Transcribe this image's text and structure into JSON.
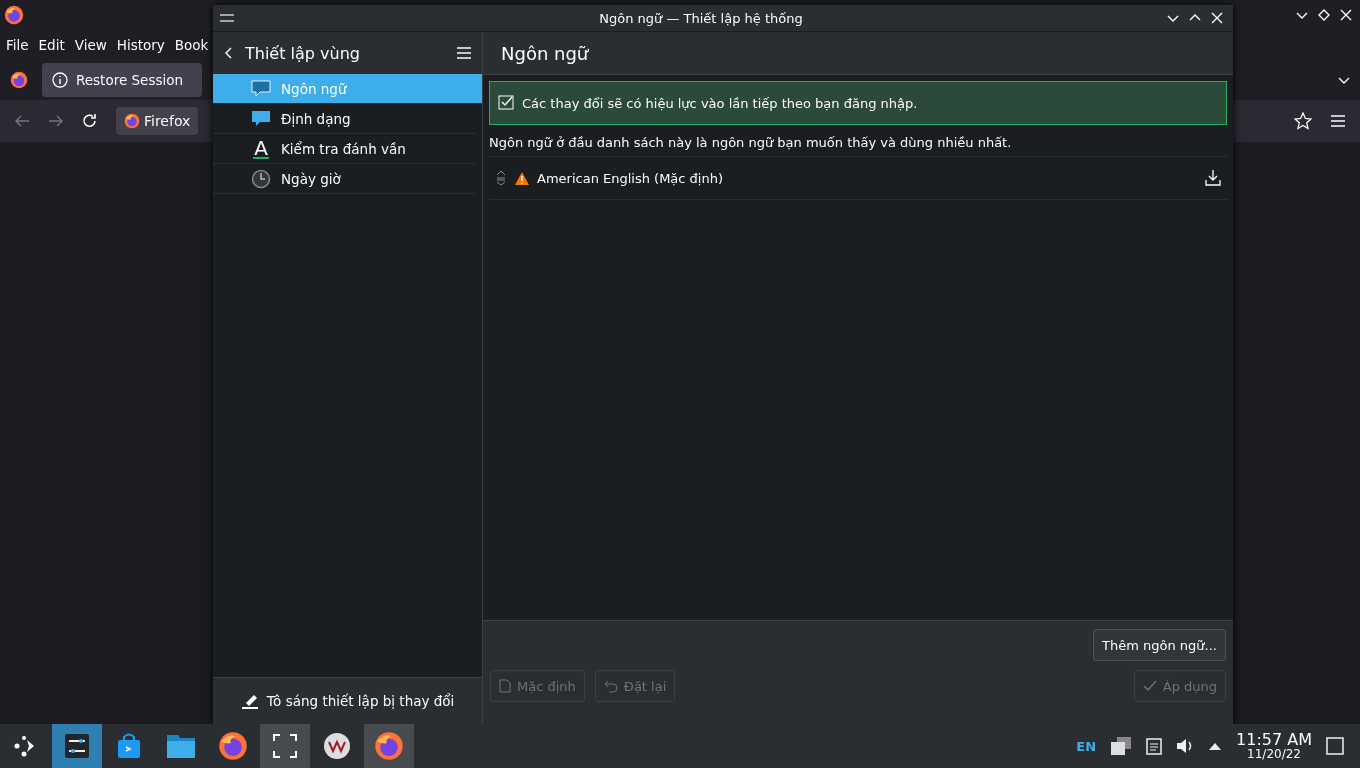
{
  "browser": {
    "menu": [
      "File",
      "Edit",
      "View",
      "History",
      "Book"
    ],
    "tab": {
      "label": "Restore Session"
    },
    "identity": "Firefox"
  },
  "dialog": {
    "title": "Ngôn ngữ — Thiết lập hệ thống",
    "sidebar": {
      "title": "Thiết lập vùng",
      "items": [
        {
          "label": "Ngôn ngữ",
          "kind": "chat",
          "selected": true
        },
        {
          "label": "Định dạng",
          "kind": "chat",
          "selected": false
        },
        {
          "label": "Kiểm tra đánh vần",
          "kind": "letter",
          "icon_text": "A",
          "selected": false
        },
        {
          "label": "Ngày giờ",
          "kind": "clock",
          "selected": false
        }
      ],
      "footer": "Tô sáng thiết lập bị thay đổi"
    },
    "page": {
      "title": "Ngôn ngữ",
      "message": "Các thay đổi sẽ có hiệu lực vào lần tiếp theo bạn đăng nhập.",
      "description": "Ngôn ngữ ở đầu danh sách này là ngôn ngữ bạn muốn thấy và dùng nhiều nhất.",
      "languages": [
        {
          "name": "American English (Mặc định)",
          "warning": true
        }
      ],
      "add_button": "Thêm ngôn ngữ...",
      "buttons": [
        {
          "label": "Mặc định",
          "kind": "defaults",
          "disabled": true
        },
        {
          "label": "Đặt lại",
          "kind": "reset",
          "disabled": true
        },
        {
          "label": "Áp dụng",
          "kind": "apply",
          "disabled": true
        }
      ]
    }
  },
  "taskbar": {
    "tasks": [
      {
        "kind": "launcher",
        "selected": false,
        "running": false
      },
      {
        "kind": "settings",
        "selected": true,
        "running": true
      },
      {
        "kind": "store",
        "selected": false,
        "running": false
      },
      {
        "kind": "files",
        "selected": false,
        "running": false
      },
      {
        "kind": "firefox",
        "selected": false,
        "running": false
      },
      {
        "kind": "screenshot",
        "selected": false,
        "running": true
      },
      {
        "kind": "vm",
        "selected": false,
        "running": false
      },
      {
        "kind": "firefox",
        "selected": false,
        "running": true
      }
    ],
    "language": "EN",
    "time": "11:57 AM",
    "date": "11/20/22"
  }
}
